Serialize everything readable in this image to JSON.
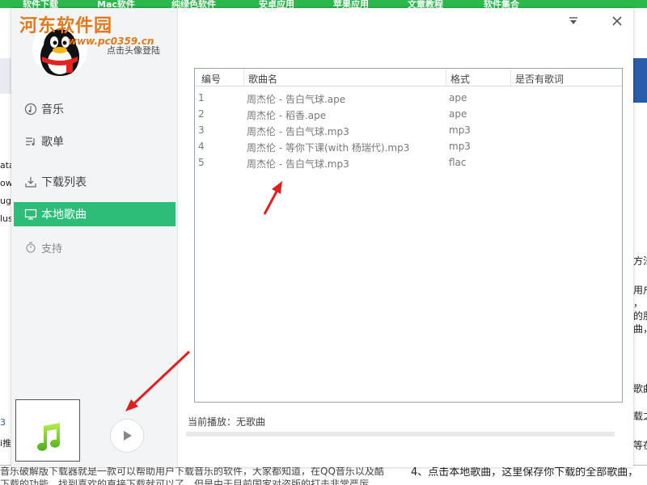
{
  "background_page": {
    "nav_items": [
      "软件下载",
      "Mac软件",
      "纯绿色软件",
      "安卓应用",
      "苹果应用",
      "文章教程",
      "软件集合"
    ],
    "left_fragments": [
      "ata",
      "ow",
      "ug",
      "lus"
    ],
    "right_fragments": [
      "方法",
      "用户",
      "，",
      "的朋",
      "曲，",
      "歌曲",
      "载之",
      "等在"
    ],
    "bottom_text": "音乐破解版下载器就是一款可以帮助用户下载音乐的软件，大家都知道，在QQ音乐以及酷",
    "bottom_text_2": "4、点击本地歌曲，这里保存你下载的全部歌曲，",
    "left_number": "3",
    "left_word": "i推",
    "bottom_line2": "下载的功能，找到喜欢的直接下载就可以了，但是由于目前国家对盗版的打击非常严厉"
  },
  "watermark": {
    "title": "河东软件园",
    "url": "www.pc0359.cn"
  },
  "header": {
    "login_prompt": "点击头像登陆"
  },
  "window_controls": {
    "menu_icon": "▼",
    "close_icon": "✕"
  },
  "nav": {
    "items": [
      {
        "label": "音乐",
        "icon": "music-icon"
      },
      {
        "label": "歌单",
        "icon": "playlist-icon"
      },
      {
        "label": "下载列表",
        "icon": "download-icon"
      },
      {
        "label": "本地歌曲",
        "icon": "monitor-icon",
        "active": true
      },
      {
        "label": "支持",
        "icon": "support-icon"
      }
    ]
  },
  "table": {
    "headers": [
      "编号",
      "歌曲名",
      "格式",
      "是否有歌词"
    ],
    "rows": [
      [
        "1",
        "周杰伦 - 告白气球.ape",
        "ape",
        ""
      ],
      [
        "2",
        "周杰伦 - 稻香.ape",
        "ape",
        ""
      ],
      [
        "3",
        "周杰伦 - 告白气球.mp3",
        "mp3",
        ""
      ],
      [
        "4",
        "周杰伦 - 等你下课(with 杨瑞代).mp3",
        "mp3",
        ""
      ],
      [
        "5",
        "周杰伦 - 告白气球.mp3",
        "flac",
        ""
      ]
    ]
  },
  "player": {
    "now_playing": "当前播放：无歌曲",
    "progress": 0
  },
  "colors": {
    "accent": "#2ebd78",
    "arrow": "#e02020",
    "nav_bg": "#2db84c"
  }
}
